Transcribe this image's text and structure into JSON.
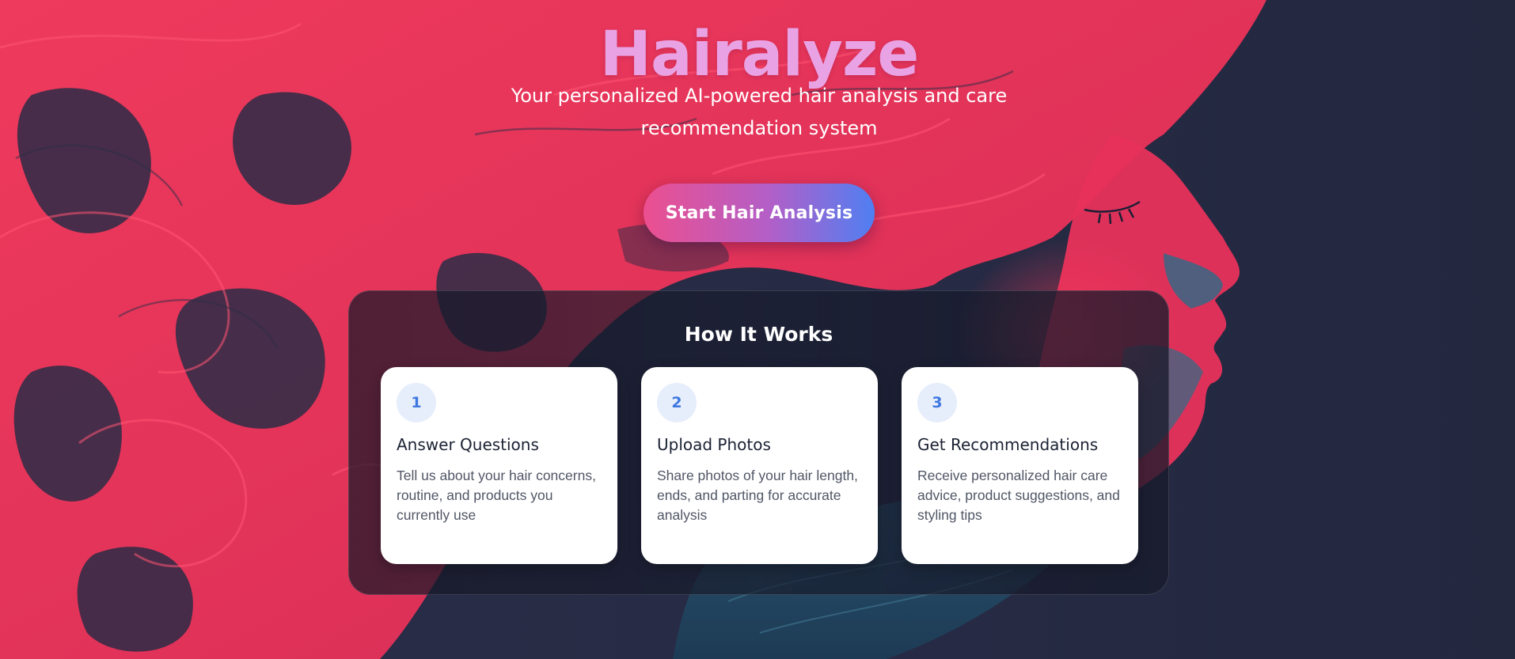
{
  "hero": {
    "title": "Hairalyze",
    "subtitle": "Your personalized AI-powered hair analysis and care recommendation system",
    "cta_label": "Start Hair Analysis"
  },
  "how_it_works": {
    "title": "How It Works",
    "steps": [
      {
        "number": "1",
        "title": "Answer Questions",
        "description": "Tell us about your hair concerns, routine, and products you currently use"
      },
      {
        "number": "2",
        "title": "Upload Photos",
        "description": "Share photos of your hair length, ends, and parting for accurate analysis"
      },
      {
        "number": "3",
        "title": "Get Recommendations",
        "description": "Receive personalized hair care advice, product suggestions, and styling tips"
      }
    ]
  },
  "colors": {
    "background": "#23283f",
    "hair": "#ff3a5c",
    "title": "#e9a3e4",
    "cta_start": "#ec4f8f",
    "cta_end": "#4f7ff2",
    "step_number": "#3f78e0"
  }
}
